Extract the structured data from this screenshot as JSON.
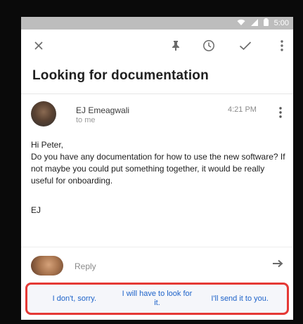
{
  "status_bar": {
    "time": "5:00"
  },
  "toolbar": {
    "icons": [
      "close-icon",
      "pin-icon",
      "clock-icon",
      "check-icon",
      "more-vert-icon"
    ]
  },
  "email": {
    "subject": "Looking for documentation",
    "sender": "EJ Emeagwali",
    "recipient": "to me",
    "time": "4:21 PM",
    "greeting": "Hi Peter,",
    "body": "Do you have any documentation for how to use the new software? If not maybe you could put something together, it would be really useful for onboarding.",
    "signoff": "EJ"
  },
  "reply": {
    "label": "Reply"
  },
  "smart_replies": [
    {
      "label": "I don't, sorry."
    },
    {
      "label": "I will have to look for it."
    },
    {
      "label": "I'll send it to you."
    }
  ],
  "colors": {
    "status_bar": "#bdbdbd",
    "link_blue": "#1e63c9",
    "highlight_red": "#e53935"
  }
}
